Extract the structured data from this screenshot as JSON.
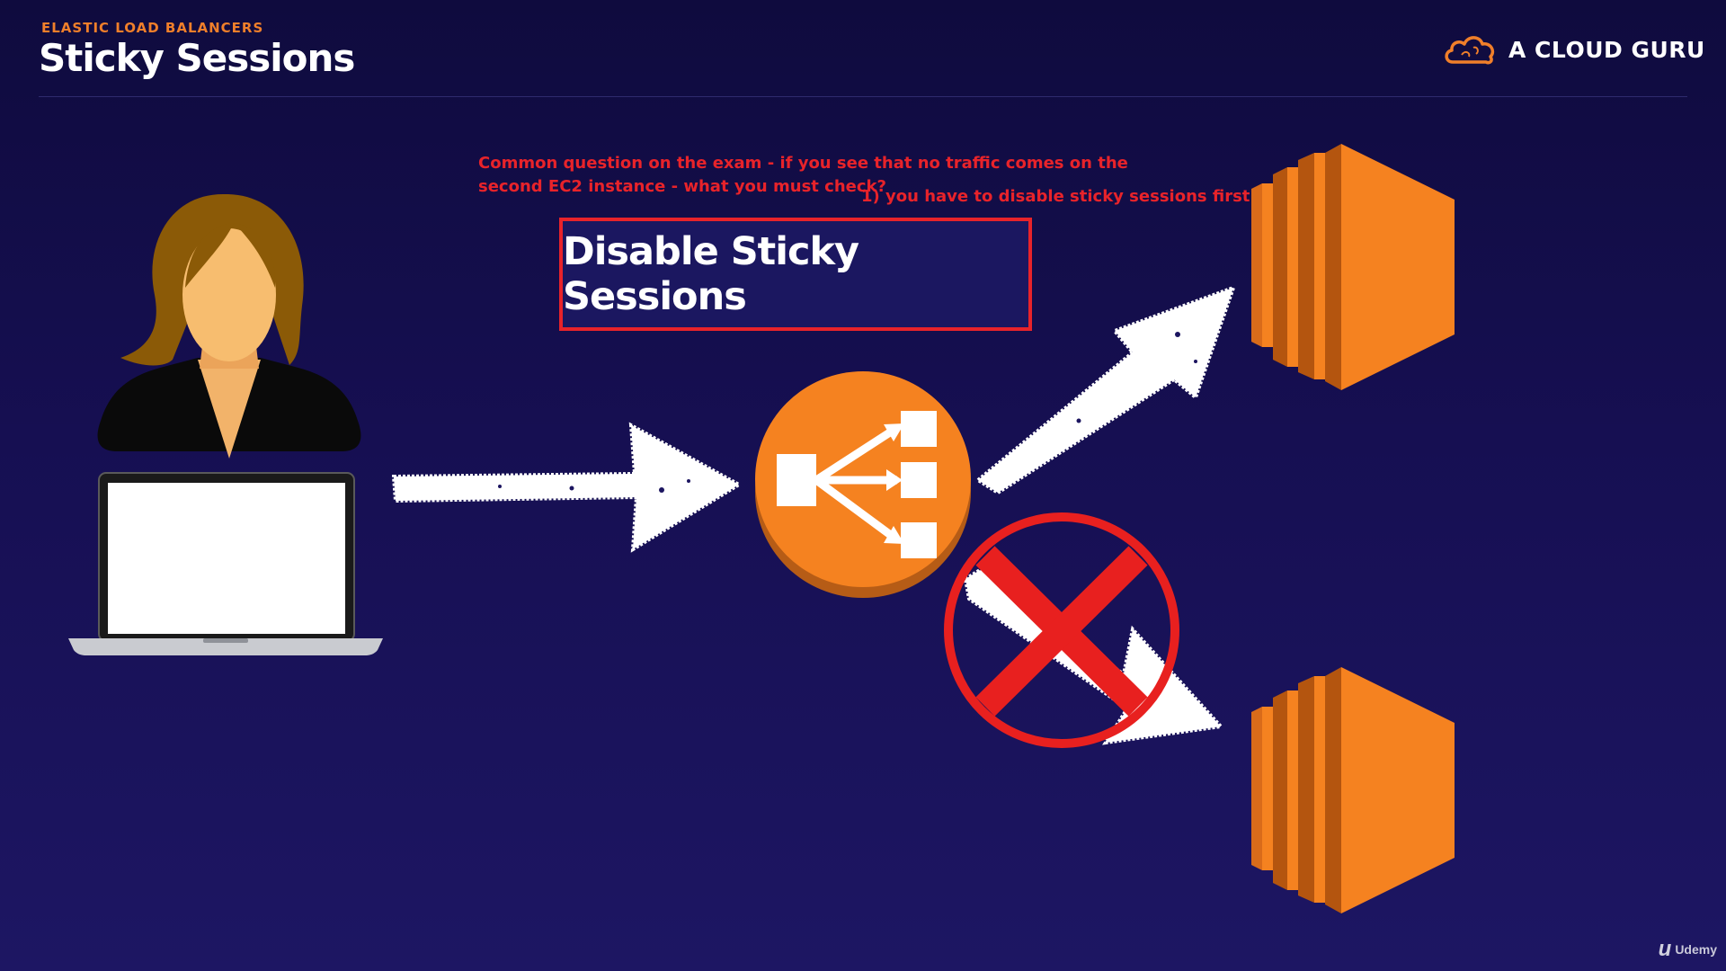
{
  "header": {
    "section_label": "ELASTIC LOAD BALANCERS",
    "title": "Sticky Sessions"
  },
  "brand": {
    "name": "A CLOUD GURU",
    "icon": "cloud-icon"
  },
  "notes": {
    "question_line1": "Common question on the exam - if you see that no traffic comes on the",
    "question_line2": "second EC2 instance - what you must check?",
    "answer": "1) you have to disable sticky sessions first to test"
  },
  "callout": {
    "text": "Disable Sticky Sessions"
  },
  "diagram": {
    "user": "user-avatar-icon",
    "device": "laptop-icon",
    "load_balancer": "load-balancer-icon",
    "instances": [
      "ec2-instance-icon",
      "ec2-instance-icon"
    ],
    "blocked_marker": "no-entry-icon"
  },
  "footer": {
    "watermark": "Udemy"
  },
  "colors": {
    "accent_orange": "#f07f2a",
    "alert_red": "#e8232a",
    "background": "#160f52"
  }
}
